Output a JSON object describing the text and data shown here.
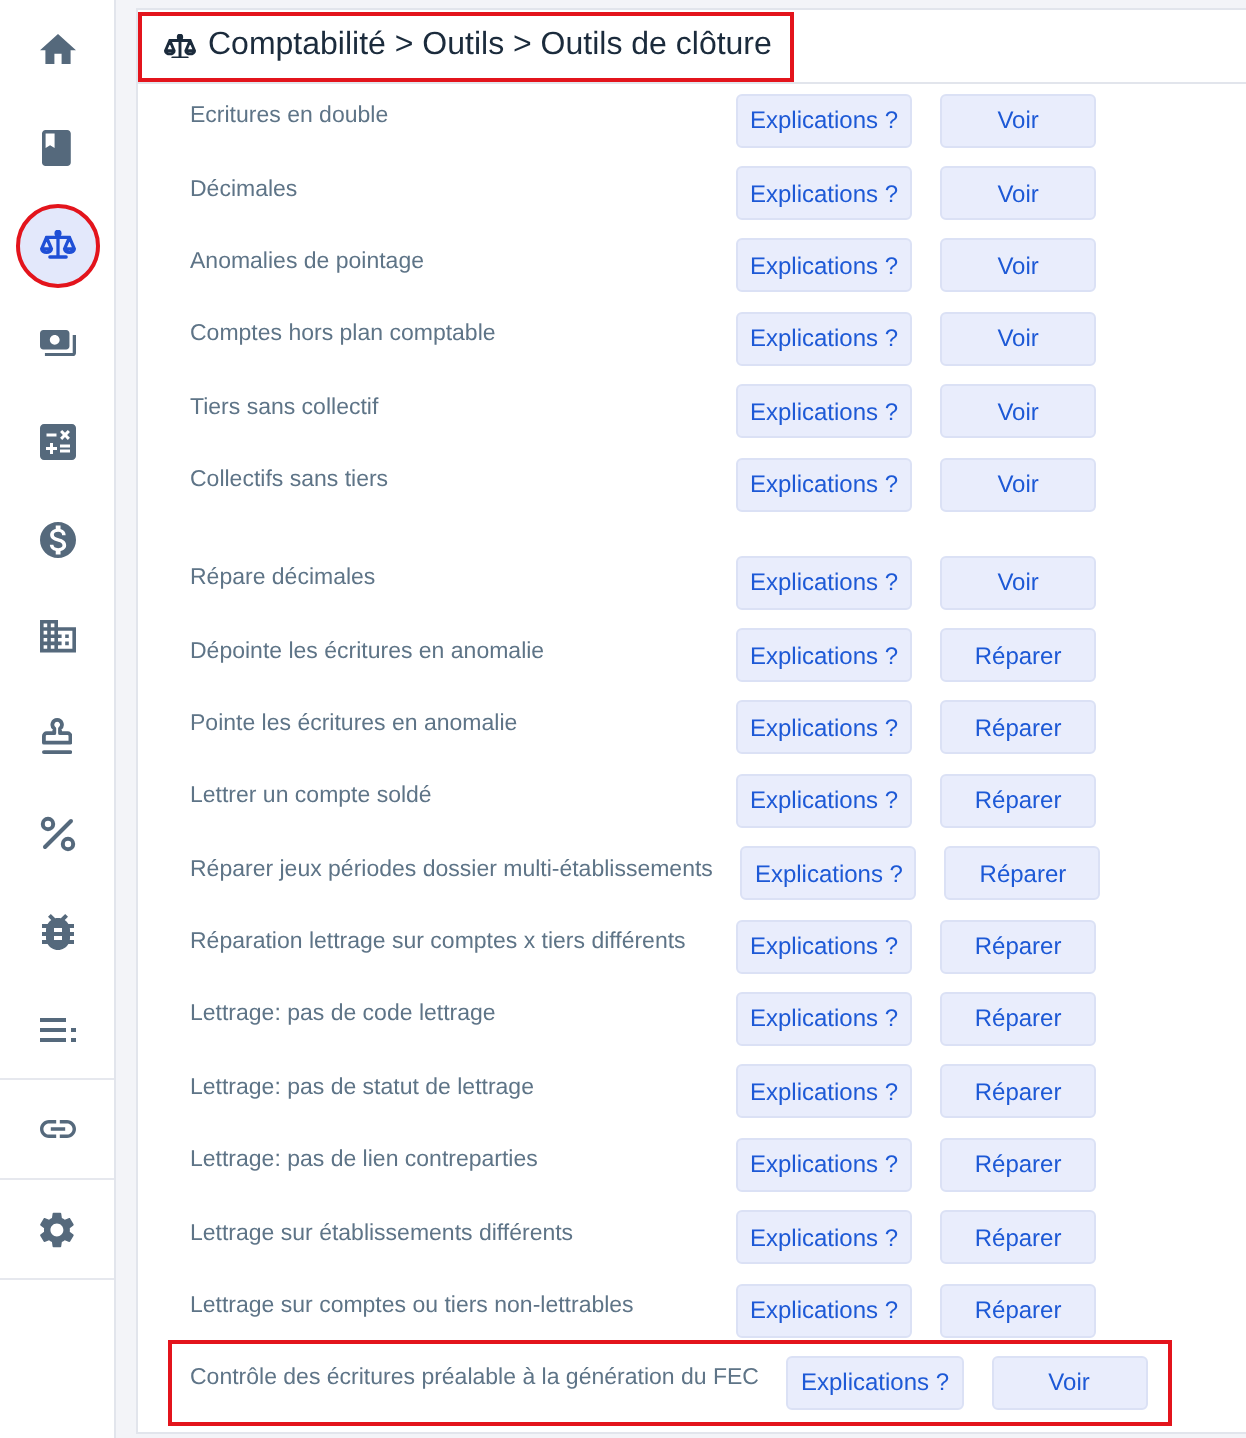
{
  "sidebar": {
    "groups": [
      {
        "items": [
          {
            "selected": false,
            "highlighted": false
          },
          {
            "selected": false,
            "highlighted": false
          },
          {
            "selected": true,
            "highlighted": true
          },
          {
            "selected": false,
            "highlighted": false
          },
          {
            "selected": false,
            "highlighted": false
          },
          {
            "selected": false,
            "highlighted": false
          },
          {
            "selected": false,
            "highlighted": false
          },
          {
            "selected": false,
            "highlighted": false
          },
          {
            "selected": false,
            "highlighted": false
          },
          {
            "selected": false,
            "highlighted": false
          },
          {
            "selected": false,
            "highlighted": false
          }
        ]
      },
      {
        "items": [
          {
            "selected": false,
            "highlighted": false
          }
        ]
      },
      {
        "items": [
          {
            "selected": false,
            "highlighted": false
          }
        ]
      }
    ]
  },
  "header": {
    "title": "Comptabilité > Outils > Outils de clôture",
    "highlighted": true
  },
  "sections": [
    {
      "tools": [
        {
          "label": "Ecritures en double",
          "buttons": [
            "Explications ?",
            "Voir"
          ],
          "highlighted": false
        },
        {
          "label": "Décimales",
          "buttons": [
            "Explications ?",
            "Voir"
          ],
          "highlighted": false
        },
        {
          "label": "Anomalies de pointage",
          "buttons": [
            "Explications ?",
            "Voir"
          ],
          "highlighted": false
        },
        {
          "label": "Comptes hors plan comptable",
          "buttons": [
            "Explications ?",
            "Voir"
          ],
          "highlighted": false
        },
        {
          "label": "Tiers sans collectif",
          "buttons": [
            "Explications ?",
            "Voir"
          ],
          "highlighted": false
        },
        {
          "label": "Collectifs sans tiers",
          "buttons": [
            "Explications ?",
            "Voir"
          ],
          "highlighted": false
        }
      ]
    },
    {
      "tools": [
        {
          "label": "Répare décimales",
          "buttons": [
            "Explications ?",
            "Voir"
          ],
          "highlighted": false
        },
        {
          "label": "Dépointe les écritures en anomalie",
          "buttons": [
            "Explications ?",
            "Réparer"
          ],
          "highlighted": false
        },
        {
          "label": "Pointe les écritures en anomalie",
          "buttons": [
            "Explications ?",
            "Réparer"
          ],
          "highlighted": false
        },
        {
          "label": "Lettrer un compte soldé",
          "buttons": [
            "Explications ?",
            "Réparer"
          ],
          "highlighted": false
        },
        {
          "label": "Réparer jeux périodes dossier multi-établissements",
          "buttons": [
            "Explications ?",
            "Réparer"
          ],
          "highlighted": false
        },
        {
          "label": "Réparation lettrage sur comptes x tiers différents",
          "buttons": [
            "Explications ?",
            "Réparer"
          ],
          "highlighted": false
        },
        {
          "label": "Lettrage: pas de code lettrage",
          "buttons": [
            "Explications ?",
            "Réparer"
          ],
          "highlighted": false
        },
        {
          "label": "Lettrage: pas de statut de lettrage",
          "buttons": [
            "Explications ?",
            "Réparer"
          ],
          "highlighted": false
        },
        {
          "label": "Lettrage: pas de lien contreparties",
          "buttons": [
            "Explications ?",
            "Réparer"
          ],
          "highlighted": false
        },
        {
          "label": "Lettrage sur établissements différents",
          "buttons": [
            "Explications ?",
            "Réparer"
          ],
          "highlighted": false
        },
        {
          "label": "Lettrage sur comptes ou tiers non-lettrables",
          "buttons": [
            "Explications ?",
            "Réparer"
          ],
          "highlighted": false
        },
        {
          "label": "Contrôle des écritures préalable à la génération du FEC",
          "buttons": [
            "Explications ?",
            "Voir"
          ],
          "highlighted": true
        }
      ]
    }
  ]
}
